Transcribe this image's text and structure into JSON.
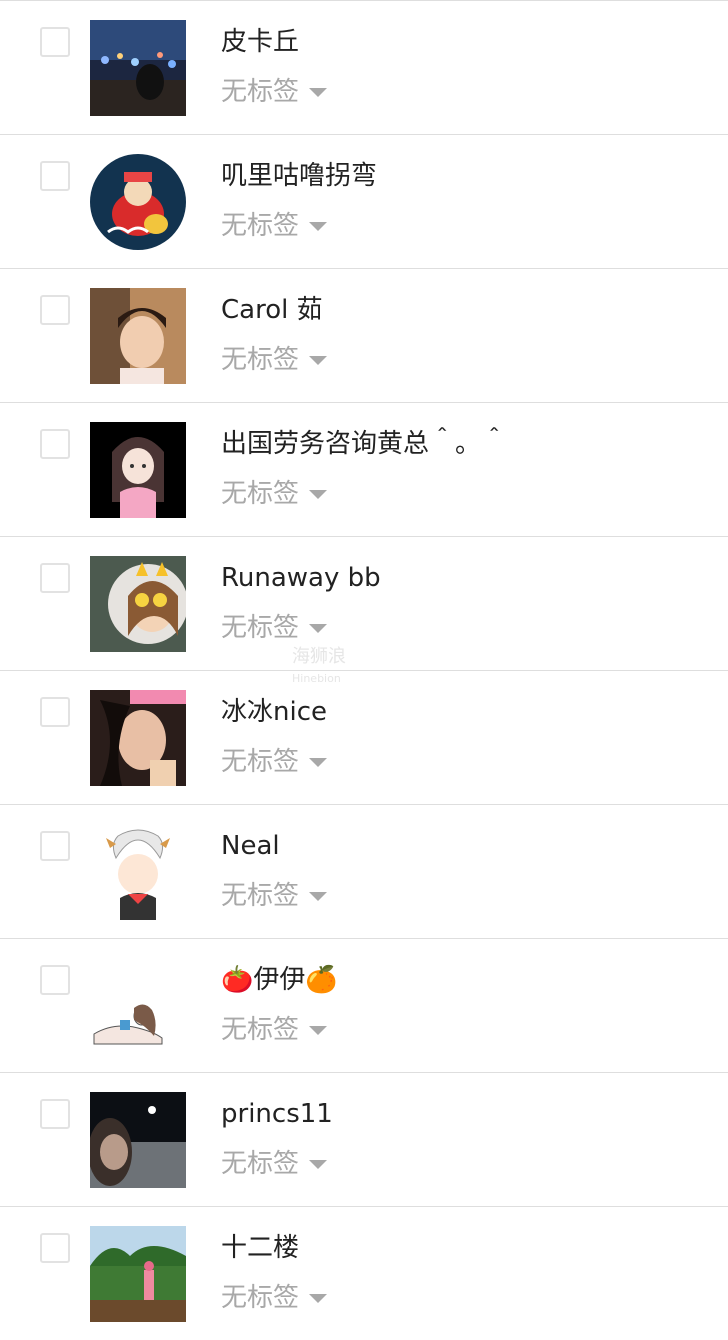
{
  "contacts": [
    {
      "name": "皮卡丘",
      "tag": "无标签"
    },
    {
      "name": "叽里咕噜拐弯",
      "tag": "无标签"
    },
    {
      "name": "Carol 茹",
      "tag": "无标签"
    },
    {
      "name": "出国劳务咨询黄总＾。＾",
      "tag": "无标签"
    },
    {
      "name": "Runaway bb",
      "tag": "无标签"
    },
    {
      "name": "冰冰nice",
      "tag": "无标签"
    },
    {
      "name": "Neal",
      "tag": "无标签"
    },
    {
      "name": "🍅伊伊🍊",
      "tag": "无标签"
    },
    {
      "name": "princs11",
      "tag": "无标签"
    },
    {
      "name": "十二楼",
      "tag": "无标签"
    }
  ],
  "watermark": {
    "line1": "海狮浪",
    "line2": "Hinebion"
  },
  "icons": {
    "checkbox": "checkbox-icon",
    "caret": "caret-down-icon"
  },
  "colors": {
    "name_text": "#222222",
    "tag_text": "#a8a8a8",
    "divider": "#dedede",
    "checkbox_border": "#e2e2e2"
  }
}
